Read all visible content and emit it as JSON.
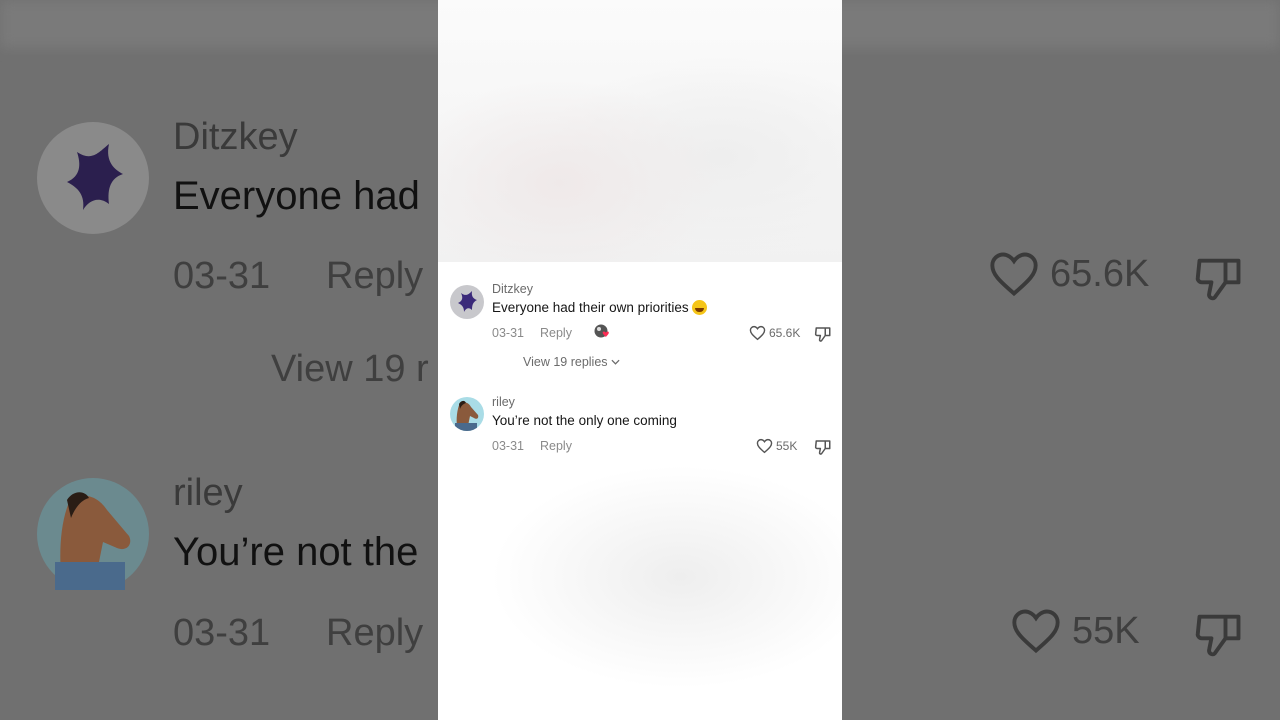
{
  "comments": [
    {
      "username": "Ditzkey",
      "text": "Everyone had their own priorities",
      "emoji": "grinning-sweat-emoji",
      "date": "03-31",
      "reply_label": "Reply",
      "likes": "65.6K",
      "view_replies": "View 19 replies"
    },
    {
      "username": "riley",
      "text": "You’re not the only one coming",
      "date": "03-31",
      "reply_label": "Reply",
      "likes": "55K"
    }
  ],
  "background": {
    "name_1": "Ditzkey",
    "text_1": "Everyone had",
    "date_1": "03-31",
    "reply_1": "Reply",
    "likes_1": "65.6K",
    "view_1": "View 19 r",
    "name_2": "riley",
    "text_2": "You’re not the",
    "date_2": "03-31",
    "reply_2": "Reply",
    "likes_2": "55K"
  },
  "colors": {
    "background_dim": "#707070",
    "panel": "#ffffff",
    "muted_text": "#8a8a8a",
    "primary_text": "#161616"
  }
}
